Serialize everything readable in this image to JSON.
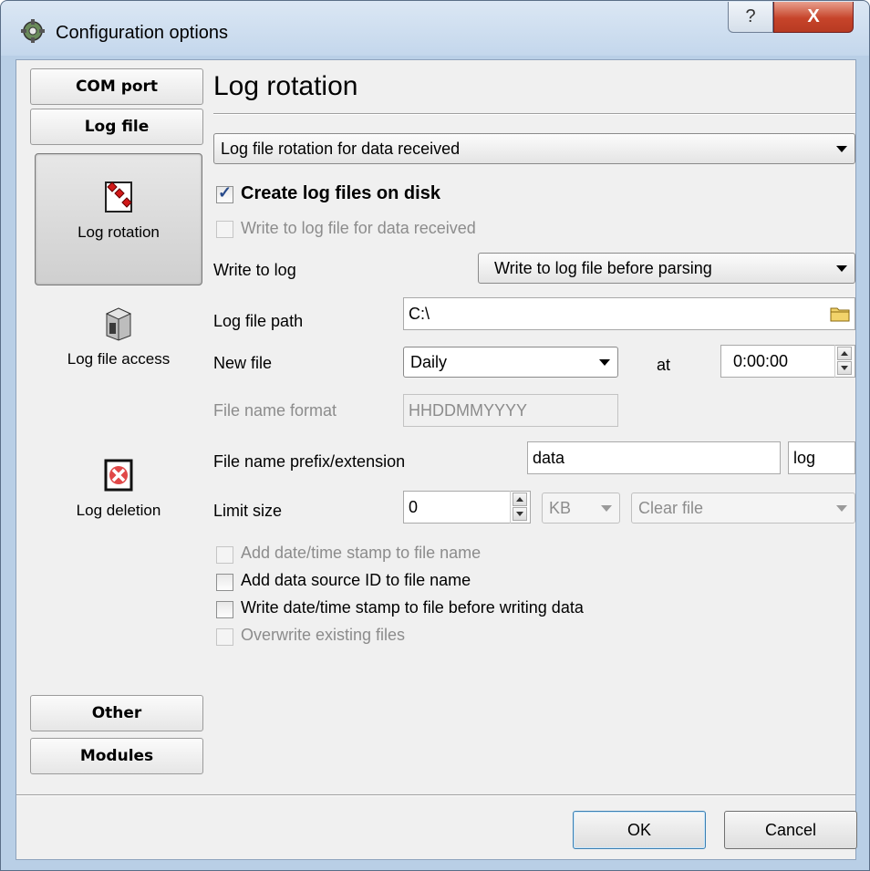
{
  "window": {
    "title": "Configuration options",
    "help_glyph": "?",
    "close_glyph": "X"
  },
  "nav": {
    "com_port": "COM port",
    "log_file": "Log file",
    "items": [
      {
        "label": "Log rotation",
        "icon": "diamonds-icon"
      },
      {
        "label": "Log file access",
        "icon": "server-icon"
      },
      {
        "label": "Log deletion",
        "icon": "delete-icon"
      }
    ],
    "other": "Other",
    "modules": "Modules"
  },
  "panel": {
    "heading": "Log rotation",
    "rotation_select": "Log file rotation for data received",
    "create_log_files": {
      "label": "Create log files on disk",
      "checked": true
    },
    "write_log_received": {
      "label": "Write to log file for data received",
      "checked": false,
      "disabled": true
    },
    "write_to_log": {
      "label": "Write to log",
      "value": "Write to log file before parsing"
    },
    "log_file_path": {
      "label": "Log file path",
      "value": "C:\\"
    },
    "new_file": {
      "label": "New file",
      "value": "Daily",
      "at_label": "at",
      "time": "0:00:00"
    },
    "file_name_format": {
      "label": "File name format",
      "value": "HHDDMMYYYY"
    },
    "prefix_extension": {
      "label": "File name prefix/extension",
      "prefix": "data",
      "extension": "log"
    },
    "limit_size": {
      "label": "Limit size",
      "value": "0",
      "unit": "KB",
      "action": "Clear file"
    },
    "checkboxes": [
      {
        "label": "Add date/time stamp to file name",
        "checked": false,
        "disabled": true
      },
      {
        "label": "Add data source ID to file name",
        "checked": false,
        "disabled": false
      },
      {
        "label": "Write date/time stamp to file before writing data",
        "checked": false,
        "disabled": false
      },
      {
        "label": "Overwrite existing files",
        "checked": false,
        "disabled": true
      }
    ]
  },
  "buttons": {
    "ok": "OK",
    "cancel": "Cancel"
  }
}
